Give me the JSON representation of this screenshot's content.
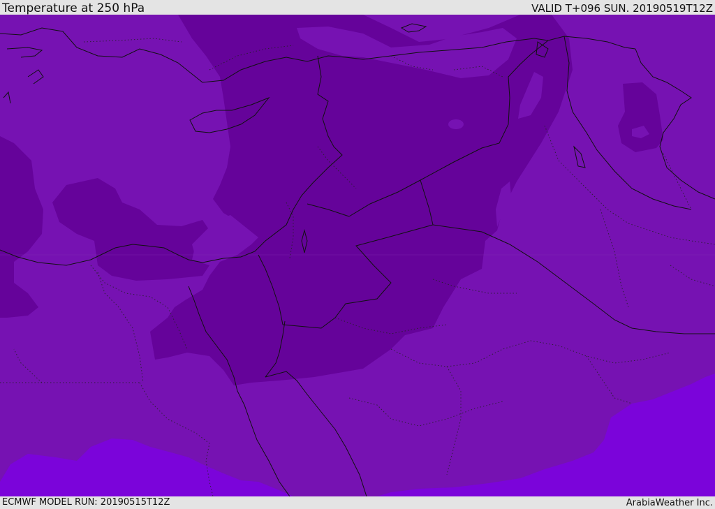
{
  "header": {
    "title": "Temperature at 250 hPa",
    "valid": "VALID T+096 SUN. 20190519T12Z"
  },
  "footer": {
    "model_run": "ECMWF MODEL RUN: 20190515T12Z",
    "credit": "ArabiaWeather Inc."
  },
  "colors": {
    "base_field": "#7612b2",
    "cold_field": "#65039a",
    "warm_field": "#7b04da",
    "bar_background": "#e4e4e4"
  }
}
